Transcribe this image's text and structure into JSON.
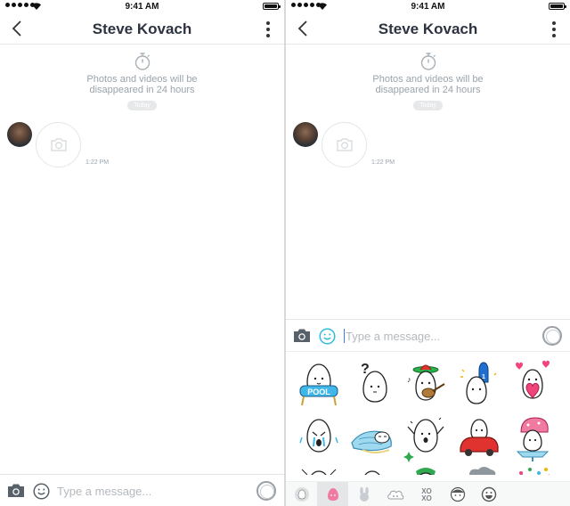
{
  "status_bar": {
    "time": "9:41 AM"
  },
  "conversation": {
    "contact_name": "Steve Kovach",
    "notice_text": "Photos and videos will be disappeared in 24 hours",
    "date_badge": "Today",
    "message": {
      "time": "1:22 PM"
    }
  },
  "composer": {
    "placeholder": "Type a message..."
  },
  "icons": {
    "back": "chevron-left-icon",
    "more": "more-vertical-icon",
    "timer": "stopwatch-icon",
    "camera": "camera-icon",
    "emoji": "smiley-icon",
    "record": "record-circle-icon"
  },
  "stickers": [
    {
      "name": "sticker-rice-ball-pool-floaty",
      "accent": "#3fb7e8"
    },
    {
      "name": "sticker-rice-ball-question",
      "accent": "#222222"
    },
    {
      "name": "sticker-rice-ball-guitar-sombrero",
      "accent": "#29b34a"
    },
    {
      "name": "sticker-rice-ball-foam-finger",
      "accent": "#1e6fd0"
    },
    {
      "name": "sticker-rice-ball-hearts",
      "accent": "#f0457a"
    },
    {
      "name": "sticker-rice-ball-crying",
      "accent": "#3fb7e8"
    },
    {
      "name": "sticker-rice-ball-sleeping-blanket",
      "accent": "#9fd9f0"
    },
    {
      "name": "sticker-rice-ball-sparkle-wave",
      "accent": "#2fa84f"
    },
    {
      "name": "sticker-rice-ball-red-car",
      "accent": "#e0322e"
    },
    {
      "name": "sticker-rice-ball-ice-cream",
      "accent": "#f07aa0"
    }
  ],
  "sticker_tabs": [
    {
      "name": "recent-stickers-tab",
      "active": false
    },
    {
      "name": "rice-ball-stickers-tab",
      "active": true
    },
    {
      "name": "bunny-stickers-tab",
      "active": false
    },
    {
      "name": "cloud-stickers-tab",
      "active": false
    },
    {
      "name": "xoxo-stickers-tab",
      "active": false
    },
    {
      "name": "hair-face-stickers-tab",
      "active": false
    },
    {
      "name": "grin-face-stickers-tab",
      "active": false
    }
  ],
  "colors": {
    "title": "#2d3340",
    "muted": "#9aa3ab",
    "accent_blue": "#3b7bea",
    "emoji_active": "#2ebbe0"
  }
}
